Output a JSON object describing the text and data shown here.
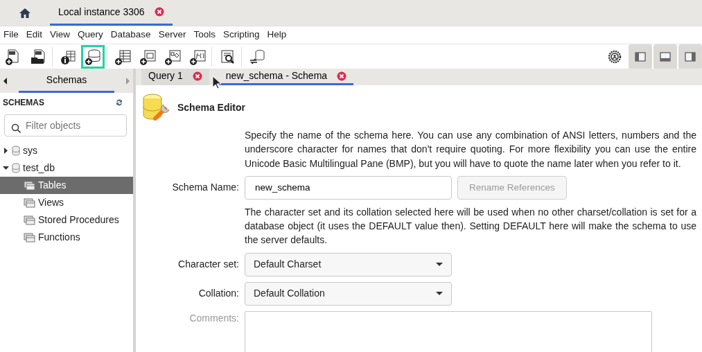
{
  "connection_tabs": [
    {
      "label": "Local instance 3306",
      "selected": true
    }
  ],
  "menu": [
    "File",
    "Edit",
    "View",
    "Query",
    "Database",
    "Server",
    "Tools",
    "Scripting",
    "Help"
  ],
  "toolbar": [
    {
      "kind": "new-sql",
      "highlighted": false
    },
    {
      "kind": "open-sql",
      "highlighted": false
    },
    {
      "kind": "info",
      "highlighted": false
    },
    {
      "kind": "new-schema",
      "highlighted": true
    },
    {
      "kind": "new-table",
      "highlighted": false
    },
    {
      "kind": "new-view",
      "highlighted": false
    },
    {
      "kind": "new-procedure",
      "highlighted": false
    },
    {
      "kind": "new-function",
      "highlighted": false
    },
    {
      "kind": "search",
      "highlighted": false
    },
    {
      "kind": "reconnect",
      "highlighted": false
    }
  ],
  "panel_toggles": [
    {
      "kind": "left",
      "on": true
    },
    {
      "kind": "bottom",
      "on": true
    },
    {
      "kind": "right",
      "on": true
    }
  ],
  "sidebar": {
    "tabs": [
      {
        "label": "Schemas",
        "selected": true
      }
    ],
    "heading": "SCHEMAS",
    "filter": {
      "placeholder": "Filter objects"
    },
    "tree": [
      {
        "label": "sys",
        "expanded": false,
        "selected": false
      },
      {
        "label": "test_db",
        "expanded": true,
        "selected": false,
        "children": [
          {
            "label": "Tables",
            "selected": true
          },
          {
            "label": "Views",
            "selected": false
          },
          {
            "label": "Stored Procedures",
            "selected": false
          },
          {
            "label": "Functions",
            "selected": false
          }
        ]
      }
    ]
  },
  "editor_tabs": [
    {
      "label": "Query 1",
      "selected": false
    },
    {
      "label": "new_schema - Schema",
      "selected": true
    }
  ],
  "editor": {
    "title": "Schema Editor",
    "rows": [
      {
        "kind": "note",
        "text": "Specify the name of the schema here. You can use any combination of ANSI letters, numbers and the underscore character for names that don't require quoting. For more flexibility you can use the entire Unicode Basic Multilingual Pane (BMP), but you will have to quote the name later when you refer to it."
      },
      {
        "kind": "text",
        "label": "Schema Name:",
        "value": "new_schema",
        "button": {
          "label": "Rename References",
          "disabled": true
        }
      },
      {
        "kind": "note",
        "text": "The character set and its collation selected here will be used when no other charset/collation is set for a database object (it uses the DEFAULT value then). Setting DEFAULT here will make the schema to use the server defaults."
      },
      {
        "kind": "select",
        "label": "Character set:",
        "value": "Default Charset"
      },
      {
        "kind": "select",
        "label": "Collation:",
        "value": "Default Collation"
      },
      {
        "kind": "textarea",
        "label": "Comments:"
      }
    ]
  }
}
